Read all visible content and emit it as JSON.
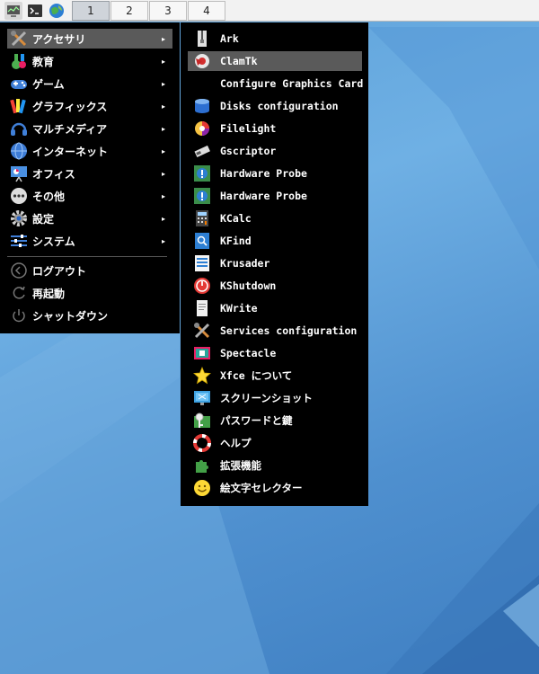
{
  "panel": {
    "launchers": [
      {
        "icon": "system-monitor-icon"
      },
      {
        "icon": "terminal-icon"
      },
      {
        "icon": "web-browser-icon"
      }
    ],
    "workspaces": [
      "1",
      "2",
      "3",
      "4"
    ],
    "active_workspace": "1"
  },
  "main_menu": {
    "categories": [
      {
        "label": "アクセサリ",
        "icon": "accessories-icon",
        "highlighted": true
      },
      {
        "label": "教育",
        "icon": "education-icon"
      },
      {
        "label": "ゲーム",
        "icon": "games-icon"
      },
      {
        "label": "グラフィックス",
        "icon": "graphics-icon"
      },
      {
        "label": "マルチメディア",
        "icon": "multimedia-icon"
      },
      {
        "label": "インターネット",
        "icon": "internet-icon"
      },
      {
        "label": "オフィス",
        "icon": "office-icon"
      },
      {
        "label": "その他",
        "icon": "other-icon"
      },
      {
        "label": "設定",
        "icon": "settings-icon"
      },
      {
        "label": "システム",
        "icon": "system-icon"
      }
    ],
    "arrow": "▸",
    "session": [
      {
        "label": "ログアウト",
        "icon": "logout-icon"
      },
      {
        "label": "再起動",
        "icon": "restart-icon"
      },
      {
        "label": "シャットダウン",
        "icon": "shutdown-icon"
      }
    ]
  },
  "accessories_submenu": {
    "items": [
      {
        "label": "Ark",
        "icon": "ark-icon"
      },
      {
        "label": "ClamTk",
        "icon": "clamtk-icon",
        "highlighted": true
      },
      {
        "label": "Configure Graphics Card",
        "icon": ""
      },
      {
        "label": "Disks configuration",
        "icon": "disks-icon"
      },
      {
        "label": "Filelight",
        "icon": "filelight-icon"
      },
      {
        "label": "Gscriptor",
        "icon": "gscriptor-icon"
      },
      {
        "label": "Hardware Probe",
        "icon": "hardware-probe-icon"
      },
      {
        "label": "Hardware Probe",
        "icon": "hardware-probe-icon"
      },
      {
        "label": "KCalc",
        "icon": "calculator-icon"
      },
      {
        "label": "KFind",
        "icon": "kfind-icon"
      },
      {
        "label": "Krusader",
        "icon": "krusader-icon"
      },
      {
        "label": "KShutdown",
        "icon": "kshutdown-icon"
      },
      {
        "label": "KWrite",
        "icon": "kwrite-icon"
      },
      {
        "label": "Services configuration",
        "icon": "services-config-icon"
      },
      {
        "label": "Spectacle",
        "icon": "spectacle-icon"
      },
      {
        "label": "Xfce について",
        "icon": "xfce-about-icon"
      },
      {
        "label": "スクリーンショット",
        "icon": "screenshot-icon"
      },
      {
        "label": "パスワードと鍵",
        "icon": "passwords-keys-icon"
      },
      {
        "label": "ヘルプ",
        "icon": "help-icon"
      },
      {
        "label": "拡張機能",
        "icon": "extensions-icon"
      },
      {
        "label": "絵文字セレクター",
        "icon": "emoji-icon"
      }
    ]
  }
}
